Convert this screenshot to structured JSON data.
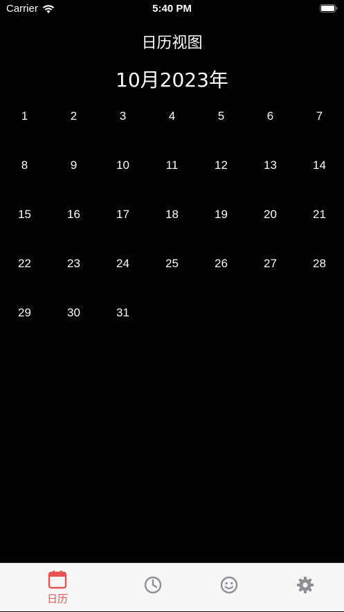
{
  "status_bar": {
    "carrier": "Carrier",
    "time": "5:40 PM"
  },
  "nav": {
    "title": "日历视图"
  },
  "calendar": {
    "month_title": "10月2023年",
    "days": [
      "1",
      "2",
      "3",
      "4",
      "5",
      "6",
      "7",
      "8",
      "9",
      "10",
      "11",
      "12",
      "13",
      "14",
      "15",
      "16",
      "17",
      "18",
      "19",
      "20",
      "21",
      "22",
      "23",
      "24",
      "25",
      "26",
      "27",
      "28",
      "29",
      "30",
      "31"
    ]
  },
  "tab_bar": {
    "tabs": [
      {
        "label": "日历",
        "icon": "calendar-icon",
        "selected": true
      },
      {
        "label": "",
        "icon": "clock-icon",
        "selected": false
      },
      {
        "label": "",
        "icon": "smiley-icon",
        "selected": false
      },
      {
        "label": "",
        "icon": "gear-icon",
        "selected": false
      }
    ]
  },
  "colors": {
    "background": "#000000",
    "text": "#ffffff",
    "accent": "#e8524f",
    "tab_inactive": "#8e8e93",
    "tab_bar_bg": "#f7f7f7"
  }
}
